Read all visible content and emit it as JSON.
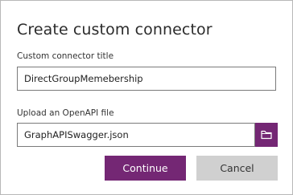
{
  "dialog": {
    "title": "Create custom connector",
    "connector_title": {
      "label": "Custom connector title",
      "value": "DirectGroupMemebership"
    },
    "openapi_upload": {
      "label": "Upload an OpenAPI file",
      "value": "GraphAPISwagger.json",
      "browse_icon": "folder-icon"
    },
    "buttons": {
      "continue_label": "Continue",
      "cancel_label": "Cancel"
    }
  },
  "colors": {
    "accent": "#742774",
    "cancel_bg": "#d0d0d0"
  }
}
